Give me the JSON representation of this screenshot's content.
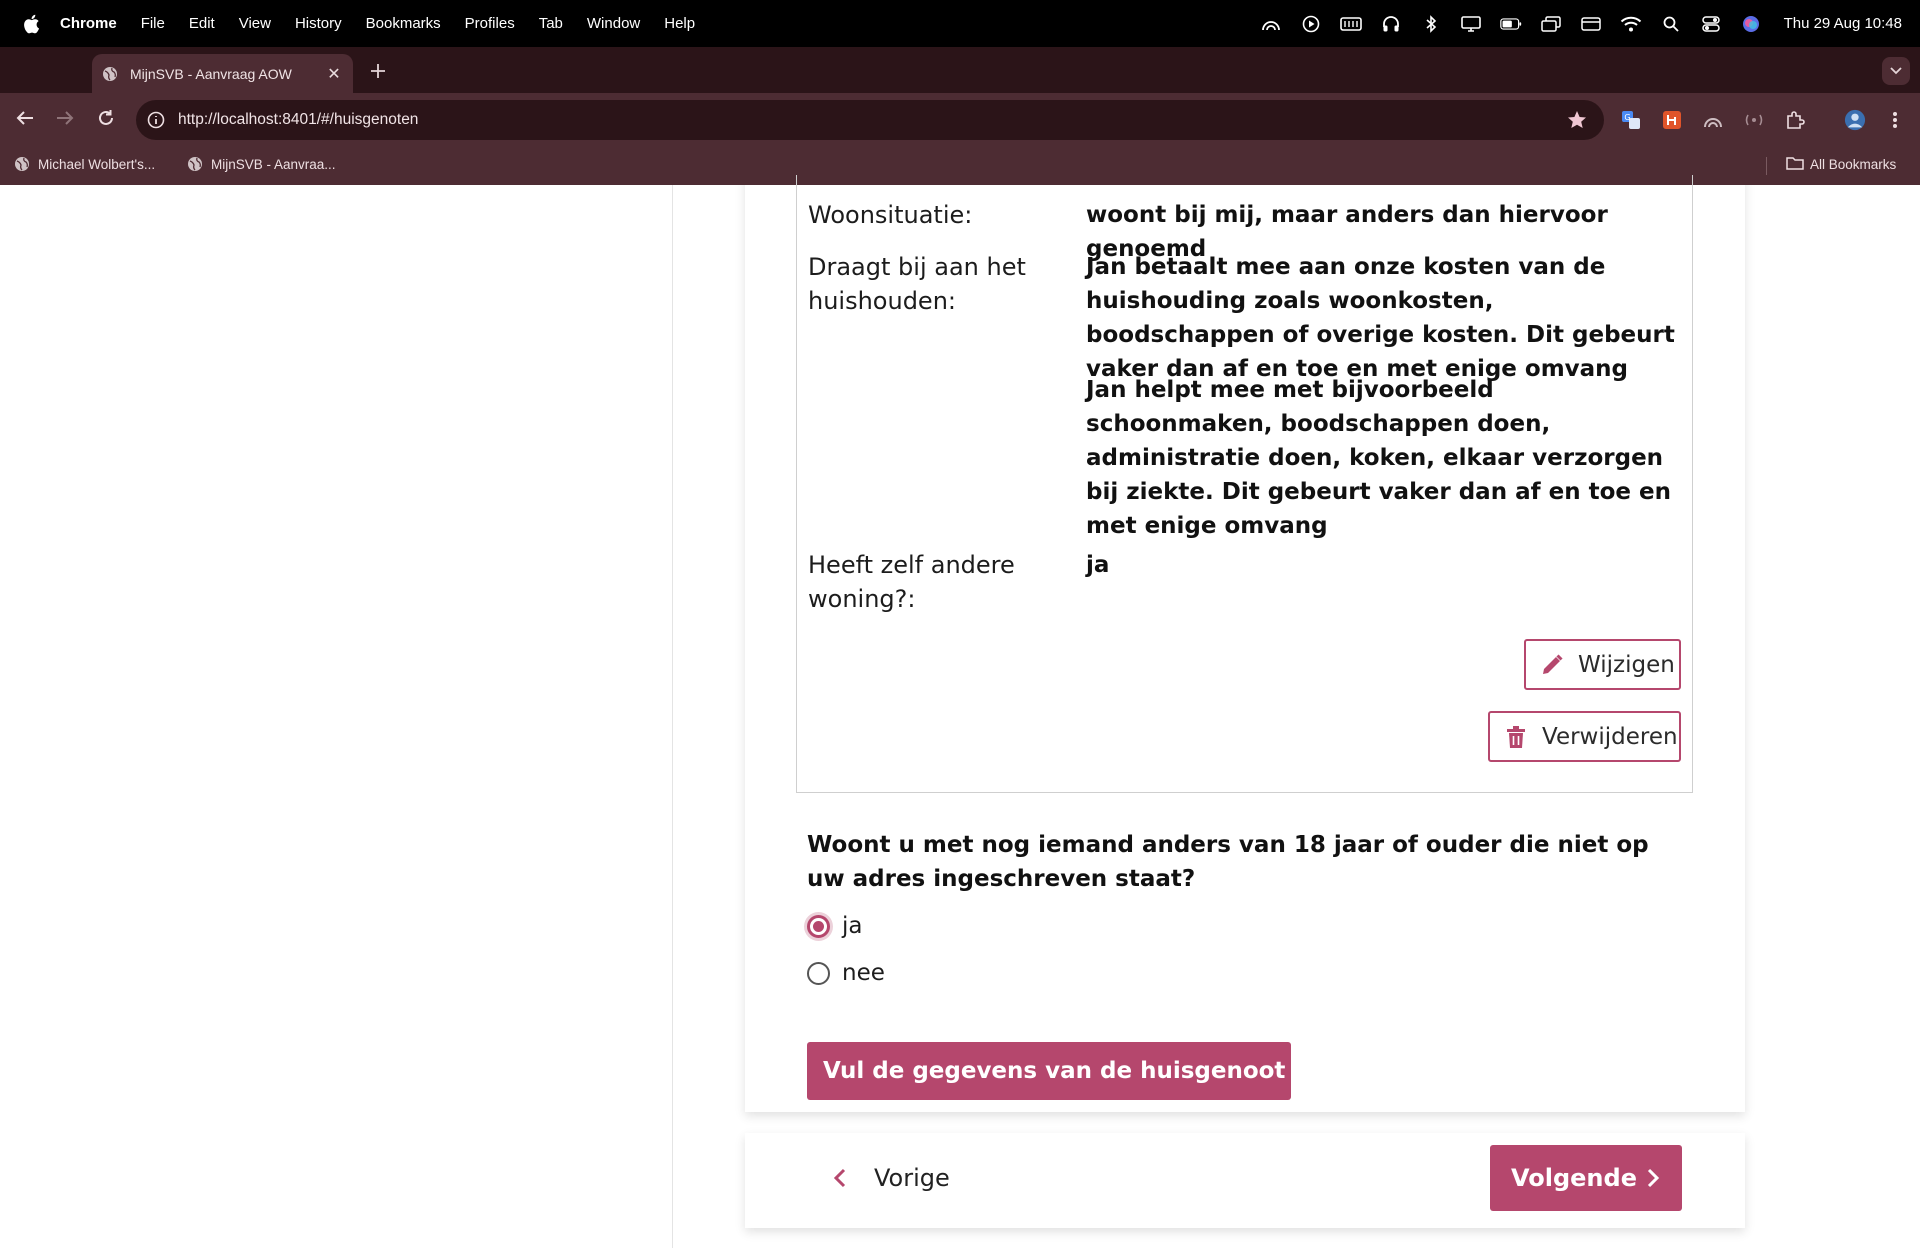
{
  "menubar": {
    "app": "Chrome",
    "items": [
      "File",
      "Edit",
      "View",
      "History",
      "Bookmarks",
      "Profiles",
      "Tab",
      "Window",
      "Help"
    ],
    "clock": "Thu 29 Aug  10:48"
  },
  "browser": {
    "tab_title": "MijnSVB - Aanvraag AOW",
    "url": "http://localhost:8401/#/huisgenoten",
    "bookmarks": [
      "Michael Wolbert's...",
      "MijnSVB - Aanvraa..."
    ],
    "all_bookmarks": "All Bookmarks"
  },
  "summary": {
    "woonsituatie_label": "Woonsituatie:",
    "woonsituatie_value": "woont bij mij, maar anders dan hiervoor genoemd",
    "draagt_label": "Draagt bij aan het huishouden:",
    "draagt_value_1": "Jan betaalt mee aan onze kosten van de huishouding zoals woonkosten, boodschappen of overige kosten. Dit gebeurt vaker dan af en toe en met enige omvang",
    "draagt_value_2": "Jan helpt mee met bijvoorbeeld schoonmaken, boodschappen doen, administratie doen, koken, elkaar verzorgen bij ziekte. Dit gebeurt vaker dan af en toe en met enige omvang",
    "woning_label": "Heeft zelf andere woning?:",
    "woning_value": "ja",
    "edit_label": "Wijzigen",
    "delete_label": "Verwijderen"
  },
  "question": {
    "text": "Woont u met nog iemand anders van 18 jaar of ouder die niet op uw adres ingeschreven staat?",
    "options": [
      "ja",
      "nee"
    ],
    "selected": "ja"
  },
  "add_housemate_label": "Vul de gegevens van de huisgenoot in",
  "footer": {
    "prev_label": "Vorige",
    "next_label": "Volgende"
  },
  "colors": {
    "accent": "#b5476d",
    "chrome_frame": "#4d2c33",
    "chrome_tabstrip": "#2b1418"
  }
}
